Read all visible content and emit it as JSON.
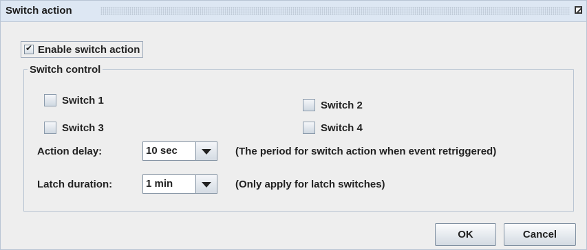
{
  "dialog": {
    "title": "Switch action"
  },
  "enable": {
    "label": "Enable switch action",
    "checked": true
  },
  "switch_control": {
    "title": "Switch control",
    "switches": [
      {
        "label": "Switch 1",
        "checked": false
      },
      {
        "label": "Switch 2",
        "checked": false
      },
      {
        "label": "Switch 3",
        "checked": false
      },
      {
        "label": "Switch 4",
        "checked": false
      }
    ],
    "action_delay": {
      "label": "Action delay:",
      "value": "10 sec",
      "hint": "(The period for switch action when event retriggered)"
    },
    "latch_duration": {
      "label": "Latch duration:",
      "value": "1 min",
      "hint": "(Only apply for latch switches)"
    }
  },
  "buttons": {
    "ok": "OK",
    "cancel": "Cancel"
  }
}
